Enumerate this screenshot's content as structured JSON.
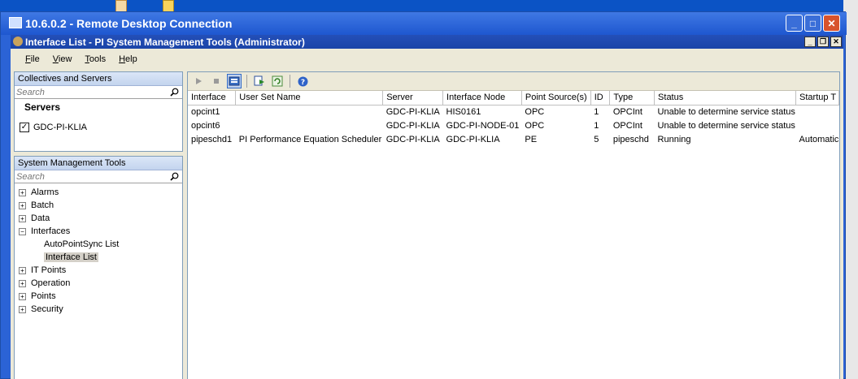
{
  "rdc": {
    "title": "10.6.0.2 - Remote Desktop Connection"
  },
  "app": {
    "title": "Interface List - PI System Management Tools (Administrator)"
  },
  "menu": [
    {
      "label": "File"
    },
    {
      "label": "View"
    },
    {
      "label": "Tools"
    },
    {
      "label": "Help"
    }
  ],
  "collectives": {
    "header": "Collectives and Servers",
    "search_placeholder": "Search",
    "servers_label": "Servers",
    "server": "GDC-PI-KLIA"
  },
  "smt": {
    "header": "System Management Tools",
    "search_placeholder": "Search",
    "tree": [
      {
        "label": "Alarms",
        "expander": "+"
      },
      {
        "label": "Batch",
        "expander": "+"
      },
      {
        "label": "Data",
        "expander": "+"
      },
      {
        "label": "Interfaces",
        "expander": "−"
      }
    ],
    "interfaces_children": [
      {
        "label": "AutoPointSync List"
      },
      {
        "label": "Interface List"
      }
    ],
    "tree_after": [
      {
        "label": "IT Points",
        "expander": "+"
      },
      {
        "label": "Operation",
        "expander": "+"
      },
      {
        "label": "Points",
        "expander": "+"
      },
      {
        "label": "Security",
        "expander": "+"
      }
    ]
  },
  "table": {
    "columns": [
      "Interface",
      "User Set Name",
      "Server",
      "Interface Node",
      "Point Source(s)",
      "ID",
      "Type",
      "Status",
      "Startup T"
    ],
    "rows": [
      [
        "opcint1",
        "",
        "GDC-PI-KLIA",
        "HIS0161",
        "OPC",
        "1",
        "OPCInt",
        "Unable to determine service status",
        ""
      ],
      [
        "opcint6",
        "",
        "GDC-PI-KLIA",
        "GDC-PI-NODE-01",
        "OPC",
        "1",
        "OPCInt",
        "Unable to determine service status",
        ""
      ],
      [
        "pipeschd1",
        "PI Performance Equation Scheduler",
        "GDC-PI-KLIA",
        "GDC-PI-KLIA",
        "PE",
        "5",
        "pipeschd",
        "Running",
        "Automatic"
      ]
    ]
  }
}
